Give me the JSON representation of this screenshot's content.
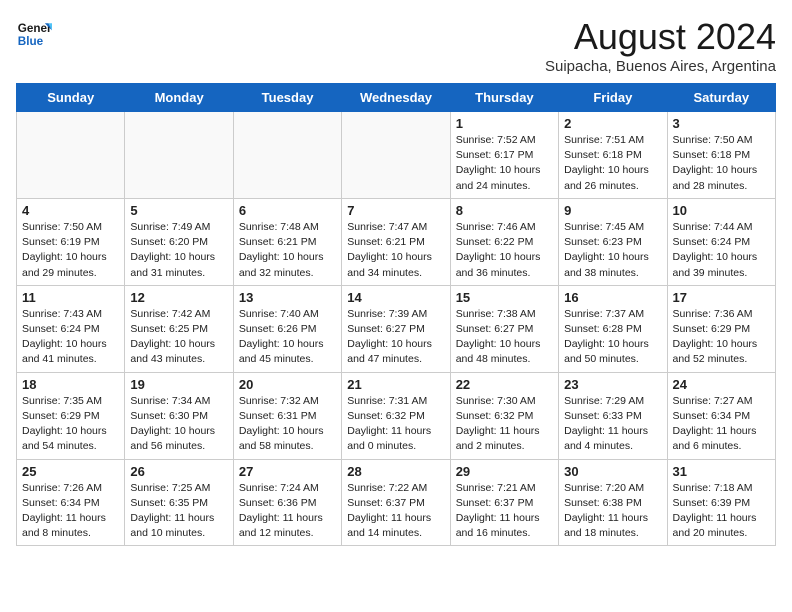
{
  "header": {
    "logo_line1": "General",
    "logo_line2": "Blue",
    "main_title": "August 2024",
    "subtitle": "Suipacha, Buenos Aires, Argentina"
  },
  "weekdays": [
    "Sunday",
    "Monday",
    "Tuesday",
    "Wednesday",
    "Thursday",
    "Friday",
    "Saturday"
  ],
  "weeks": [
    [
      {
        "day": "",
        "info": ""
      },
      {
        "day": "",
        "info": ""
      },
      {
        "day": "",
        "info": ""
      },
      {
        "day": "",
        "info": ""
      },
      {
        "day": "1",
        "info": "Sunrise: 7:52 AM\nSunset: 6:17 PM\nDaylight: 10 hours\nand 24 minutes."
      },
      {
        "day": "2",
        "info": "Sunrise: 7:51 AM\nSunset: 6:18 PM\nDaylight: 10 hours\nand 26 minutes."
      },
      {
        "day": "3",
        "info": "Sunrise: 7:50 AM\nSunset: 6:18 PM\nDaylight: 10 hours\nand 28 minutes."
      }
    ],
    [
      {
        "day": "4",
        "info": "Sunrise: 7:50 AM\nSunset: 6:19 PM\nDaylight: 10 hours\nand 29 minutes."
      },
      {
        "day": "5",
        "info": "Sunrise: 7:49 AM\nSunset: 6:20 PM\nDaylight: 10 hours\nand 31 minutes."
      },
      {
        "day": "6",
        "info": "Sunrise: 7:48 AM\nSunset: 6:21 PM\nDaylight: 10 hours\nand 32 minutes."
      },
      {
        "day": "7",
        "info": "Sunrise: 7:47 AM\nSunset: 6:21 PM\nDaylight: 10 hours\nand 34 minutes."
      },
      {
        "day": "8",
        "info": "Sunrise: 7:46 AM\nSunset: 6:22 PM\nDaylight: 10 hours\nand 36 minutes."
      },
      {
        "day": "9",
        "info": "Sunrise: 7:45 AM\nSunset: 6:23 PM\nDaylight: 10 hours\nand 38 minutes."
      },
      {
        "day": "10",
        "info": "Sunrise: 7:44 AM\nSunset: 6:24 PM\nDaylight: 10 hours\nand 39 minutes."
      }
    ],
    [
      {
        "day": "11",
        "info": "Sunrise: 7:43 AM\nSunset: 6:24 PM\nDaylight: 10 hours\nand 41 minutes."
      },
      {
        "day": "12",
        "info": "Sunrise: 7:42 AM\nSunset: 6:25 PM\nDaylight: 10 hours\nand 43 minutes."
      },
      {
        "day": "13",
        "info": "Sunrise: 7:40 AM\nSunset: 6:26 PM\nDaylight: 10 hours\nand 45 minutes."
      },
      {
        "day": "14",
        "info": "Sunrise: 7:39 AM\nSunset: 6:27 PM\nDaylight: 10 hours\nand 47 minutes."
      },
      {
        "day": "15",
        "info": "Sunrise: 7:38 AM\nSunset: 6:27 PM\nDaylight: 10 hours\nand 48 minutes."
      },
      {
        "day": "16",
        "info": "Sunrise: 7:37 AM\nSunset: 6:28 PM\nDaylight: 10 hours\nand 50 minutes."
      },
      {
        "day": "17",
        "info": "Sunrise: 7:36 AM\nSunset: 6:29 PM\nDaylight: 10 hours\nand 52 minutes."
      }
    ],
    [
      {
        "day": "18",
        "info": "Sunrise: 7:35 AM\nSunset: 6:29 PM\nDaylight: 10 hours\nand 54 minutes."
      },
      {
        "day": "19",
        "info": "Sunrise: 7:34 AM\nSunset: 6:30 PM\nDaylight: 10 hours\nand 56 minutes."
      },
      {
        "day": "20",
        "info": "Sunrise: 7:32 AM\nSunset: 6:31 PM\nDaylight: 10 hours\nand 58 minutes."
      },
      {
        "day": "21",
        "info": "Sunrise: 7:31 AM\nSunset: 6:32 PM\nDaylight: 11 hours\nand 0 minutes."
      },
      {
        "day": "22",
        "info": "Sunrise: 7:30 AM\nSunset: 6:32 PM\nDaylight: 11 hours\nand 2 minutes."
      },
      {
        "day": "23",
        "info": "Sunrise: 7:29 AM\nSunset: 6:33 PM\nDaylight: 11 hours\nand 4 minutes."
      },
      {
        "day": "24",
        "info": "Sunrise: 7:27 AM\nSunset: 6:34 PM\nDaylight: 11 hours\nand 6 minutes."
      }
    ],
    [
      {
        "day": "25",
        "info": "Sunrise: 7:26 AM\nSunset: 6:34 PM\nDaylight: 11 hours\nand 8 minutes."
      },
      {
        "day": "26",
        "info": "Sunrise: 7:25 AM\nSunset: 6:35 PM\nDaylight: 11 hours\nand 10 minutes."
      },
      {
        "day": "27",
        "info": "Sunrise: 7:24 AM\nSunset: 6:36 PM\nDaylight: 11 hours\nand 12 minutes."
      },
      {
        "day": "28",
        "info": "Sunrise: 7:22 AM\nSunset: 6:37 PM\nDaylight: 11 hours\nand 14 minutes."
      },
      {
        "day": "29",
        "info": "Sunrise: 7:21 AM\nSunset: 6:37 PM\nDaylight: 11 hours\nand 16 minutes."
      },
      {
        "day": "30",
        "info": "Sunrise: 7:20 AM\nSunset: 6:38 PM\nDaylight: 11 hours\nand 18 minutes."
      },
      {
        "day": "31",
        "info": "Sunrise: 7:18 AM\nSunset: 6:39 PM\nDaylight: 11 hours\nand 20 minutes."
      }
    ]
  ]
}
